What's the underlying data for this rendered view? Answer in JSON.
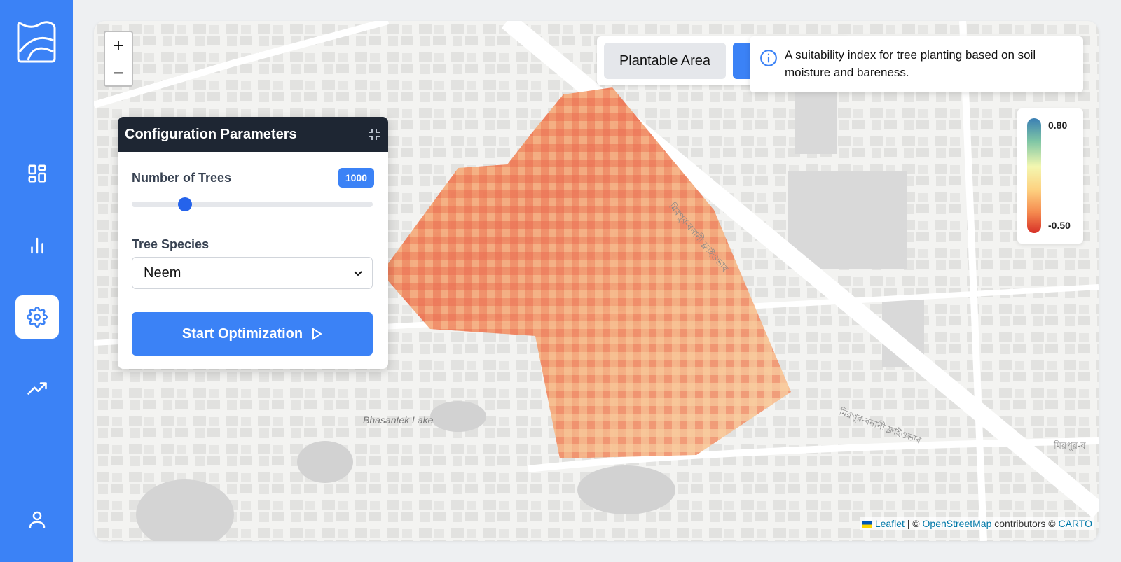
{
  "sidebar": {
    "items": [
      {
        "icon": "dashboard-icon"
      },
      {
        "icon": "bar-chart-icon"
      },
      {
        "icon": "gear-icon",
        "active": true
      },
      {
        "icon": "trending-up-icon"
      },
      {
        "icon": "user-icon"
      }
    ]
  },
  "map": {
    "zoom_in": "+",
    "zoom_out": "−",
    "labels": {
      "lake": "Bhasantek Lake",
      "road_1": "মিরপুর-বনানী ফ্লাইওভার",
      "road_2": "মিরপুর-বনানী ফ্লাইওভার",
      "road_3": "মিরপুর-ব"
    }
  },
  "config": {
    "title": "Configuration Parameters",
    "trees_label": "Number of Trees",
    "trees_value": "1000",
    "slider_fraction": 0.22,
    "species_label": "Tree Species",
    "species_selected": "Neem",
    "start_label": "Start Optimization"
  },
  "layers": {
    "plantable_label": "Plantable Area"
  },
  "tooltip": {
    "text": "A suitability index for tree planting based on soil moisture and bareness."
  },
  "legend": {
    "max": "0.80",
    "min": "-0.50"
  },
  "attribution": {
    "leaflet": "Leaflet",
    "sep1": "| ©",
    "osm": "OpenStreetMap",
    "contrib": "contributors ©",
    "carto": "CARTO"
  },
  "colors": {
    "primary": "#3b82f6",
    "header": "#1e2633"
  }
}
